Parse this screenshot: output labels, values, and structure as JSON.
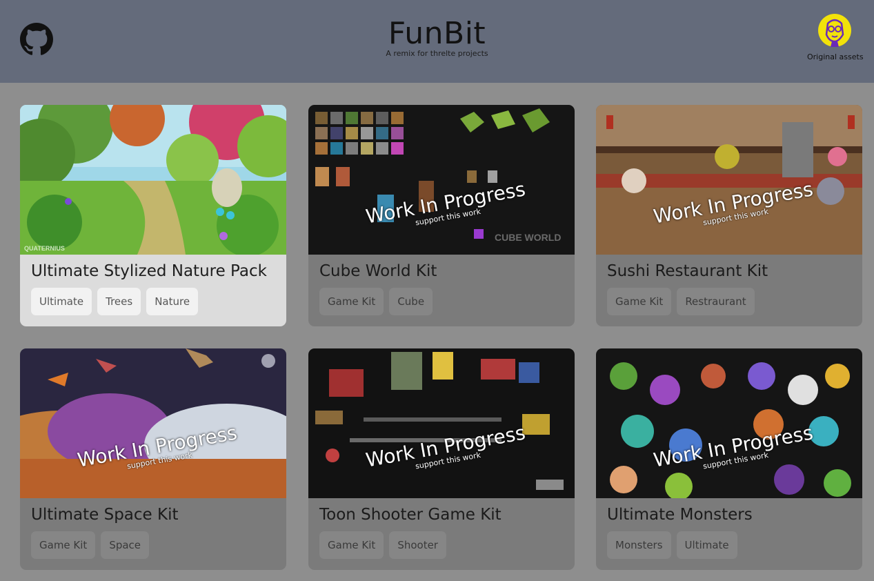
{
  "header": {
    "title": "FunBit",
    "subtitle": "A remix for threlte projects",
    "original_assets_label": "Original assets",
    "github_icon": "github-icon",
    "avatar_icon": "artist-avatar-icon",
    "colors": {
      "header_bg": "#646b7b",
      "avatar_yellow": "#f2e20a",
      "avatar_purple": "#6a2ab8"
    }
  },
  "cards": [
    {
      "title": "Ultimate Stylized Nature Pack",
      "tags": [
        "Ultimate",
        "Trees",
        "Nature"
      ],
      "wip": false,
      "watermark": "QUATERNIUS"
    },
    {
      "title": "Cube World Kit",
      "tags": [
        "Game Kit",
        "Cube"
      ],
      "wip": true,
      "wip_title": "Work In Progress",
      "wip_sub": "support this work",
      "watermark": "CUBE WORLD"
    },
    {
      "title": "Sushi Restaurant Kit",
      "tags": [
        "Game Kit",
        "Restraurant"
      ],
      "wip": true,
      "wip_title": "Work In Progress",
      "wip_sub": "support this work"
    },
    {
      "title": "Ultimate Space Kit",
      "tags": [
        "Game Kit",
        "Space"
      ],
      "wip": true,
      "wip_title": "Work In Progress",
      "wip_sub": "support this work"
    },
    {
      "title": "Toon Shooter Game Kit",
      "tags": [
        "Game Kit",
        "Shooter"
      ],
      "wip": true,
      "wip_title": "Work In Progress",
      "wip_sub": "support this work"
    },
    {
      "title": "Ultimate Monsters",
      "tags": [
        "Monsters",
        "Ultimate"
      ],
      "wip": true,
      "wip_title": "Work In Progress",
      "wip_sub": "support this work"
    }
  ]
}
